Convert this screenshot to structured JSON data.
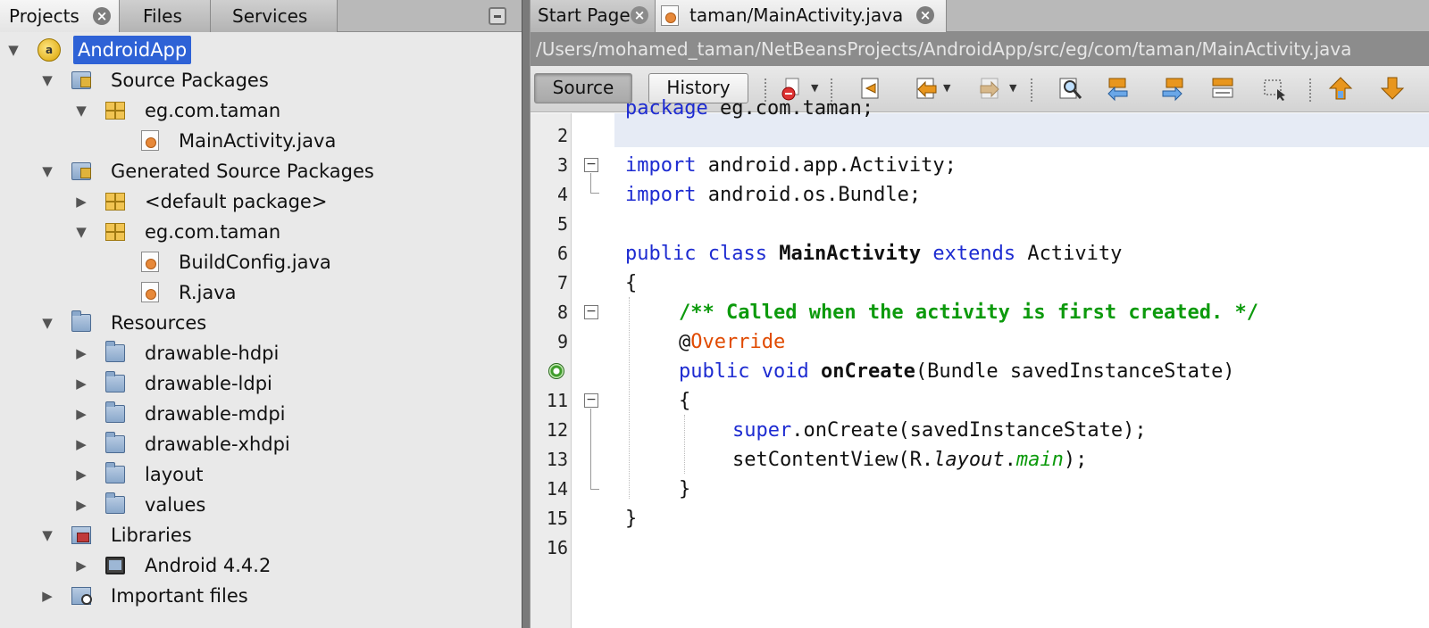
{
  "left_tabs": [
    "Projects",
    "Files",
    "Services"
  ],
  "tree": [
    {
      "label": "AndroidApp",
      "icon": "project-icon",
      "arrow": "▼"
    },
    {
      "label": "Source Packages",
      "icon": "source-folder-icon",
      "arrow": "▼"
    },
    {
      "label": "eg.com.taman",
      "icon": "package-icon",
      "arrow": "▼"
    },
    {
      "label": "MainActivity.java",
      "icon": "java-file-icon",
      "arrow": ""
    },
    {
      "label": "Generated Source Packages",
      "icon": "source-folder-icon",
      "arrow": "▼"
    },
    {
      "label": "<default package>",
      "icon": "package-icon",
      "arrow": "▶"
    },
    {
      "label": "eg.com.taman",
      "icon": "package-icon",
      "arrow": "▼"
    },
    {
      "label": "BuildConfig.java",
      "icon": "java-file-icon",
      "arrow": ""
    },
    {
      "label": "R.java",
      "icon": "java-file-icon",
      "arrow": ""
    },
    {
      "label": "Resources",
      "icon": "folder-icon",
      "arrow": "▼"
    },
    {
      "label": "drawable-hdpi",
      "icon": "folder-icon",
      "arrow": "▶"
    },
    {
      "label": "drawable-ldpi",
      "icon": "folder-icon",
      "arrow": "▶"
    },
    {
      "label": "drawable-mdpi",
      "icon": "folder-icon",
      "arrow": "▶"
    },
    {
      "label": "drawable-xhdpi",
      "icon": "folder-icon",
      "arrow": "▶"
    },
    {
      "label": "layout",
      "icon": "folder-icon",
      "arrow": "▶"
    },
    {
      "label": "values",
      "icon": "folder-icon",
      "arrow": "▶"
    },
    {
      "label": "Libraries",
      "icon": "library-folder-icon",
      "arrow": "▼"
    },
    {
      "label": "Android 4.4.2",
      "icon": "platform-icon",
      "arrow": "▶"
    },
    {
      "label": "Important files",
      "icon": "important-files-icon",
      "arrow": "▶"
    }
  ],
  "editor_tabs": [
    "Start Page",
    "taman/MainActivity.java"
  ],
  "file_path": "/Users/mohamed_taman/NetBeansProjects/AndroidApp/src/eg/com/taman/MainActivity.java",
  "toolbar": {
    "source_label": "Source",
    "history_label": "History"
  },
  "line_numbers": [
    "2",
    "3",
    "4",
    "5",
    "6",
    "7",
    "8",
    "9",
    "",
    "11",
    "12",
    "13",
    "14",
    "15",
    "16"
  ],
  "code": {
    "l3_kw": "import",
    "l3_rest": " android.app.Activity;",
    "l4_kw": "import",
    "l4_rest": " android.os.Bundle;",
    "l6_kw1": "public",
    "l6_kw2": "class",
    "l6_cls": "MainActivity",
    "l6_kw3": "extends",
    "l6_rest": " Activity",
    "l7": "{",
    "l8": "/** Called when the activity is first created. */",
    "l9_at": "@",
    "l9_ann": "Override",
    "l10_kw1": "public",
    "l10_kw2": "void",
    "l10_m": "onCreate",
    "l10_rest": "(Bundle savedInstanceState)",
    "l11": "{",
    "l12_kw": "super",
    "l12_rest": ".onCreate(savedInstanceState);",
    "l13_a": "setContentView(R.",
    "l13_b": "layout",
    "l13_c": ".",
    "l13_d": "main",
    "l13_e": ");",
    "l14": "}",
    "l15": "}"
  },
  "colors": {
    "keyword": "#1d2bd1",
    "comment": "#0c9a0c",
    "annotation": "#e04a00",
    "selection": "#2e62d6"
  }
}
